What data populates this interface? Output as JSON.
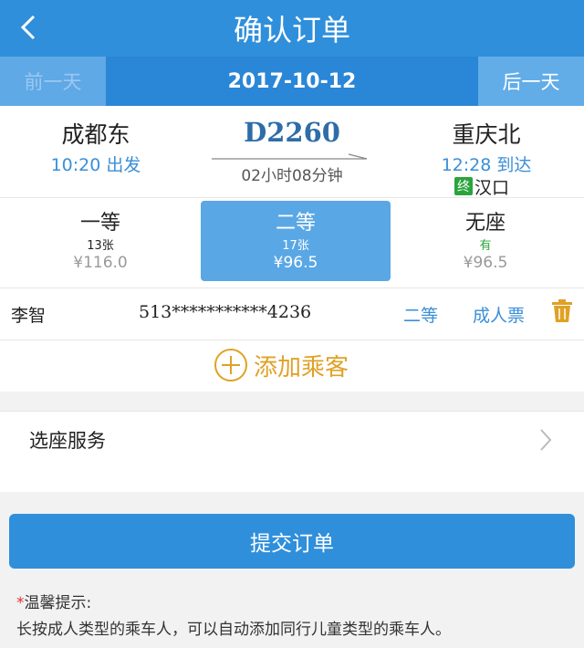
{
  "header": {
    "title": "确认订单"
  },
  "datebar": {
    "prev_label": "前一天",
    "date": "2017-10-12",
    "next_label": "后一天"
  },
  "train": {
    "from_station": "成都东",
    "from_time": "10:20 出发",
    "number": "D2260",
    "duration": "02小时08分钟",
    "to_station": "重庆北",
    "to_time": "12:28 到达",
    "terminal_badge": "终",
    "terminal_station": "汉口"
  },
  "seats": [
    {
      "name": "一等",
      "count": "13张",
      "price": "¥116.0"
    },
    {
      "name": "二等",
      "count": "17张",
      "price": "¥96.5"
    },
    {
      "name": "无座",
      "count": "有",
      "price": "¥96.5"
    }
  ],
  "passenger": {
    "name": "李智",
    "id": "513***********4236",
    "seat": "二等",
    "ticket_type": "成人票"
  },
  "add_passenger_label": "添加乘客",
  "seat_service_label": "选座服务",
  "submit_label": "提交订单",
  "tip": {
    "star": "*",
    "title": "温馨提示:",
    "text": "长按成人类型的乘车人，可以自动添加同行儿童类型的乘车人。"
  },
  "colors": {
    "primary": "#2f8fdb",
    "accent_gold": "#e0a126",
    "link_blue": "#3a8fd8",
    "green": "#2aa43c"
  }
}
